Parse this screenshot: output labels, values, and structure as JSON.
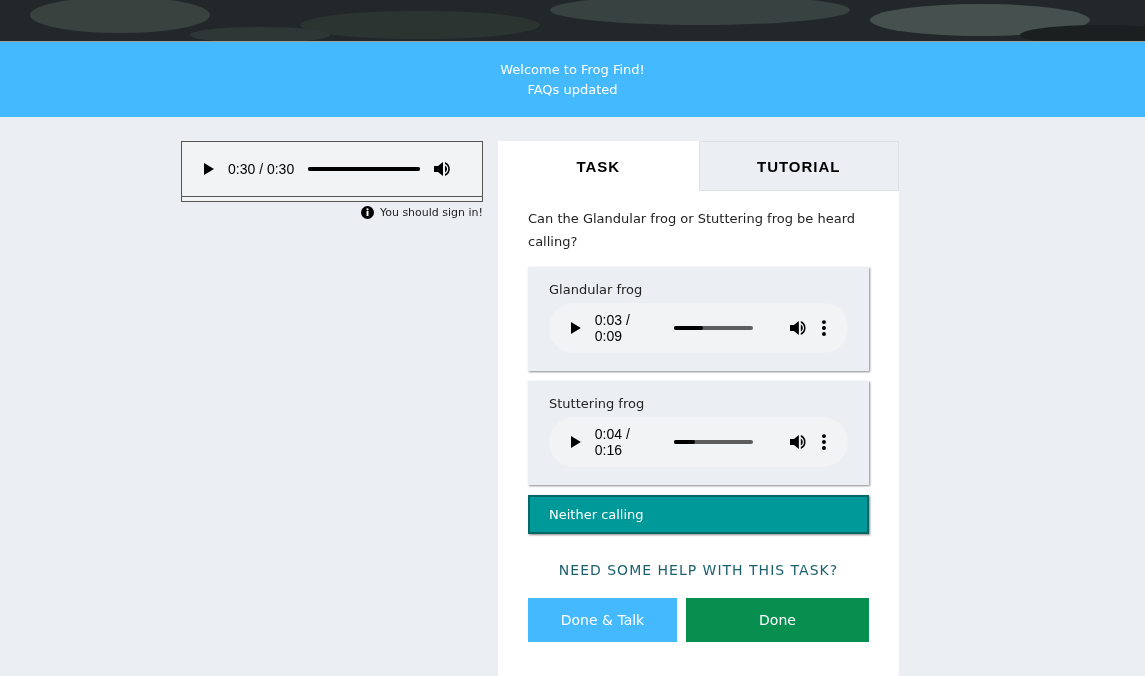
{
  "header": {
    "kind": "picture"
  },
  "announcements": [
    "Welcome to Frog Find!",
    "FAQs updated"
  ],
  "subject_player": {
    "time": "0:30 / 0:30",
    "level": 1.0
  },
  "sign_in_notice": "You should sign in!",
  "tabs": [
    {
      "label": "TASK",
      "selected": true
    },
    {
      "label": "TUTORIAL",
      "selected": false
    }
  ],
  "question": "Can the Glandular frog or Stuttering frog be heard calling?",
  "answers": [
    {
      "kind": "audio",
      "label": "Glandular frog",
      "time": "0:03 / 0:09",
      "level": 0.37,
      "selected": false
    },
    {
      "kind": "audio",
      "label": "Stuttering frog",
      "time": "0:04 / 0:16",
      "level": 0.27,
      "selected": false
    },
    {
      "kind": "plain",
      "label": "Neither calling",
      "selected": true
    }
  ],
  "help_link": "NEED SOME HELP WITH THIS TASK?",
  "buttons": [
    {
      "kind": "secondary",
      "label": "Done & Talk"
    },
    {
      "kind": "primary",
      "label": "Done"
    }
  ]
}
